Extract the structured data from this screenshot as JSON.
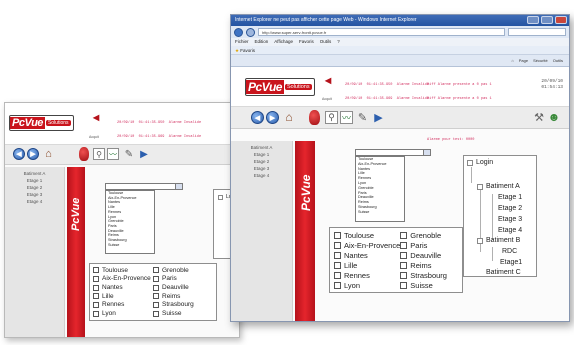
{
  "ie": {
    "title": "Internet Explorer ne peut pas afficher cette page Web - Windows Internet Explorer",
    "address": "http://www.super-serv-frontt.pcvue.fr",
    "menu": [
      "Fichier",
      "Edition",
      "Affichage",
      "Favoris",
      "Outils",
      "?"
    ],
    "favorites": "Favoris",
    "cmd": [
      "Page",
      "Sécurité",
      "Outils"
    ]
  },
  "logo": {
    "brand": "PcVue",
    "tag": "Solutions"
  },
  "redbar_text": "PcVue",
  "alarms": [
    "20/09/10  01:41:35.950  Alarme Invalide",
    "20/09/10  01:41:35.969  Alarme Invalide",
    "20/09/10  01:41:36.004  Alarme Invalide",
    "20/09/10  01:41:36.001  Alarme Invalide"
  ],
  "alarm_status": [
    "Diff Alarme presente a 0 pas 1",
    "Diff Alarme presente a 0 pas 1",
    "Diff Alarme presente a 0 pas 1",
    "Diff Alarme presente a 0 pas 1",
    "Alarme pour test: 0000"
  ],
  "bell_label": "Acquit",
  "clock": {
    "date": "20/09/10",
    "time": "01:54:13"
  },
  "sidebar": [
    "Batiment A",
    "Etage 1",
    "Etage 2",
    "Etage 3",
    "Etage 4"
  ],
  "cities_list": [
    "Toulouse",
    "Aix-En-Provence",
    "Nantes",
    "Lille",
    "Rennes",
    "Lyon",
    "Grenoble",
    "Paris",
    "Deauville",
    "Reims",
    "Strasbourg",
    "Suisse"
  ],
  "checkboxes": [
    "Toulouse",
    "Grenoble",
    "Aix-En-Provence",
    "Paris",
    "Nantes",
    "Deauville",
    "Lille",
    "Reims",
    "Rennes",
    "Strasbourg",
    "Lyon",
    "Suisse"
  ],
  "tree": {
    "root": "Login",
    "items": [
      "Batiment A",
      "Etage 1",
      "Etage 2",
      "Etage 3",
      "Etage 4",
      "Batiment B",
      "RDC",
      "Etage1",
      "Batiment C"
    ]
  }
}
